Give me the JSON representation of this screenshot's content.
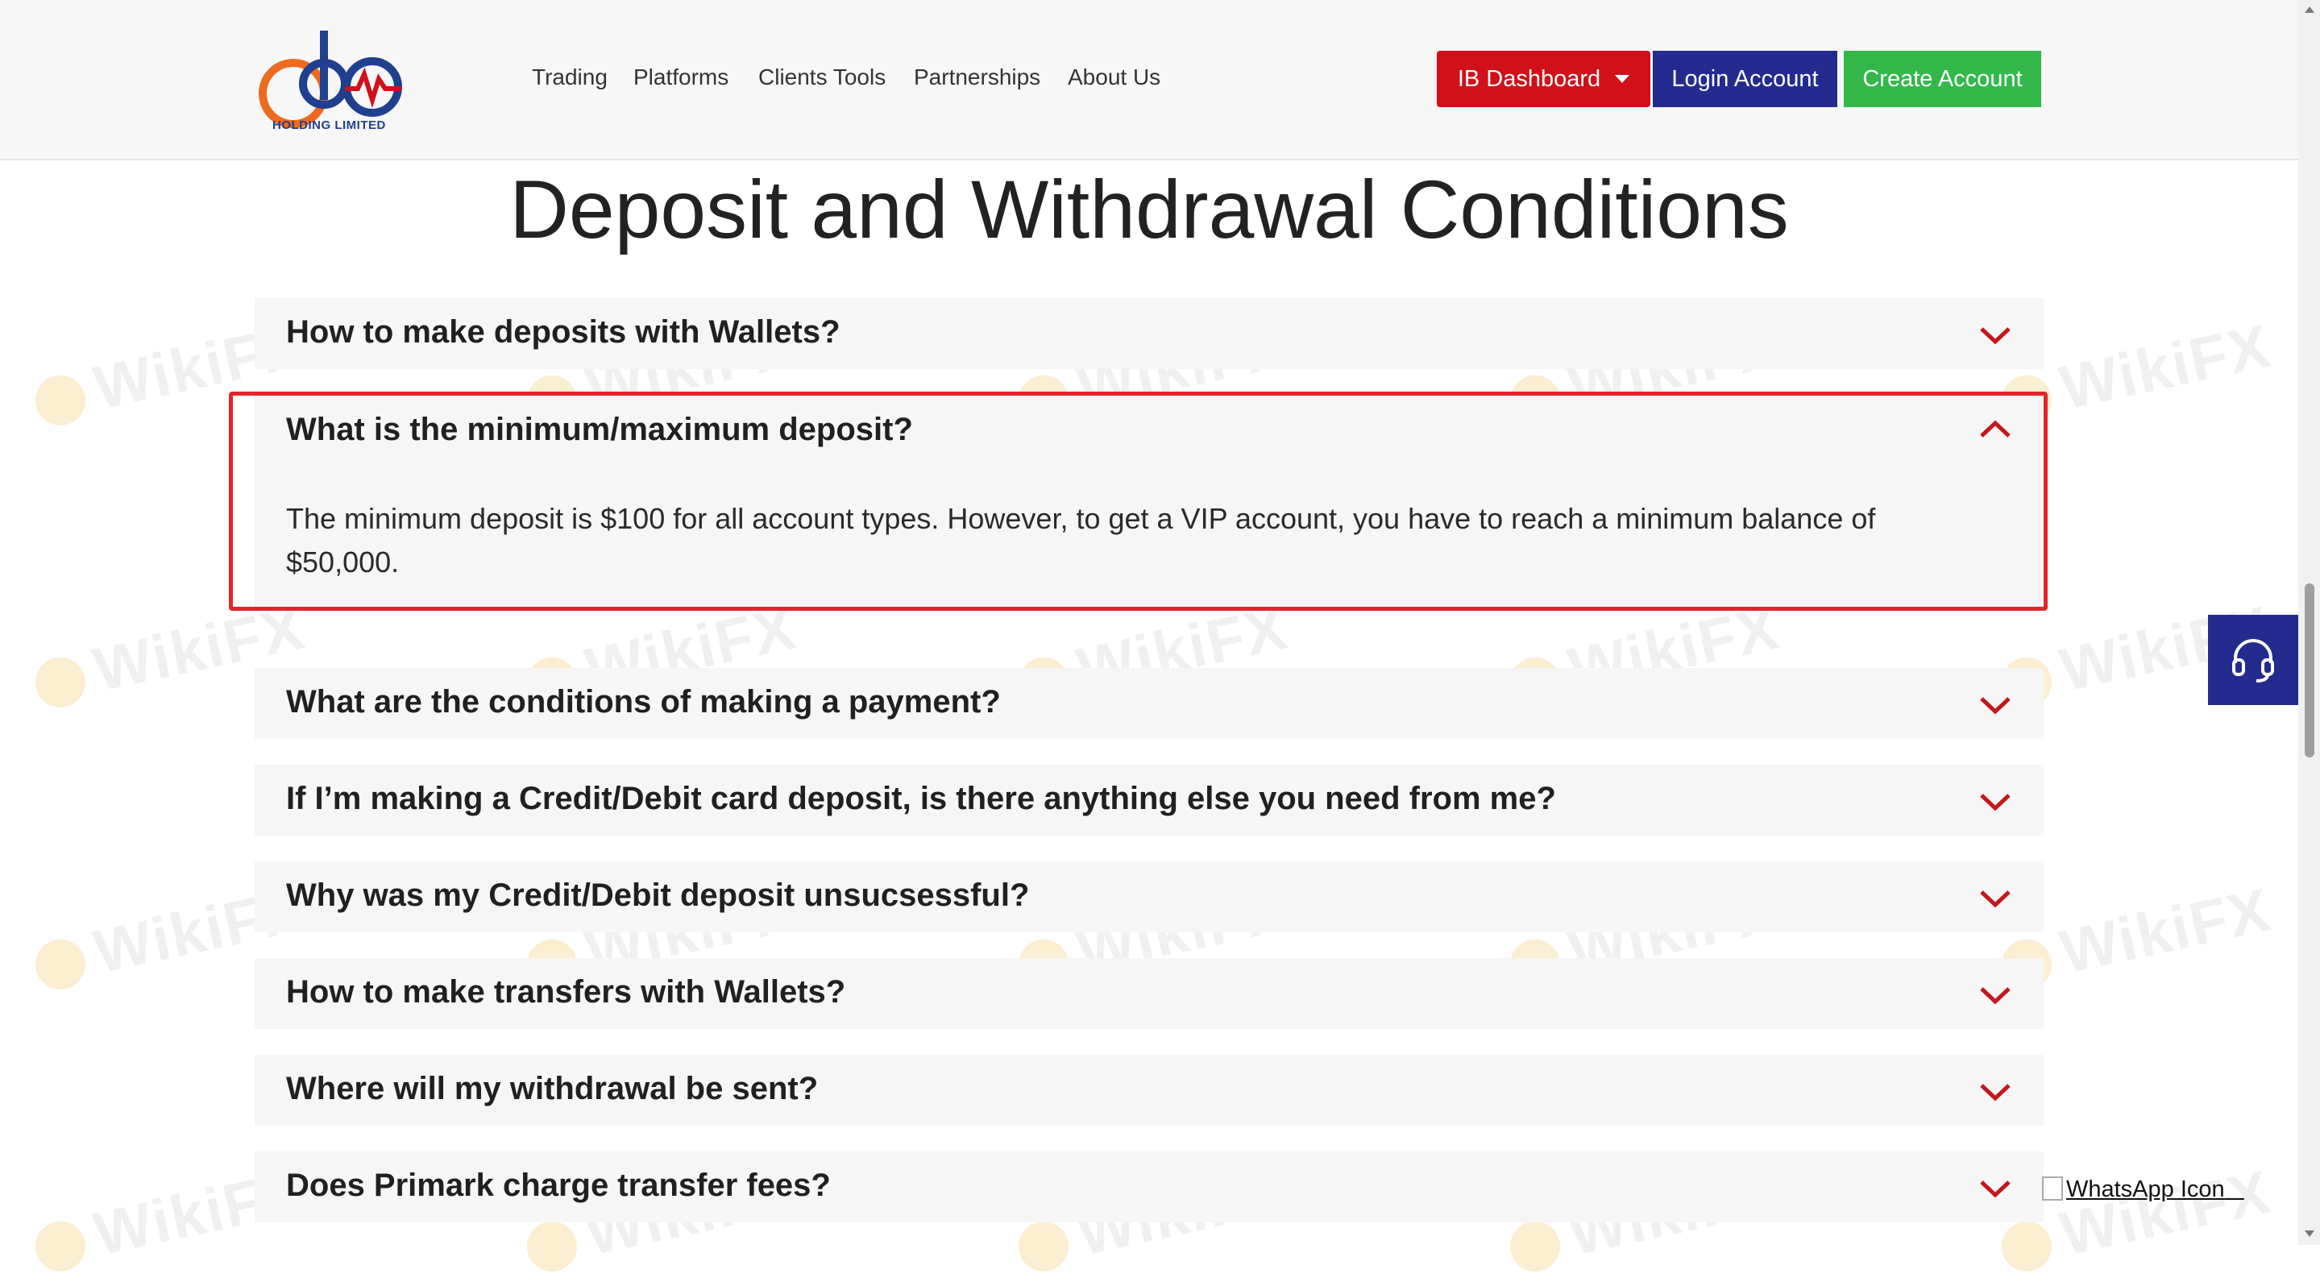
{
  "header": {
    "logo_caption": "HOLDING LIMITED",
    "nav": [
      "Trading",
      "Platforms",
      "Clients Tools",
      "Partnerships",
      "About Us"
    ],
    "buttons": {
      "ib_dashboard": "IB Dashboard",
      "login": "Login Account",
      "create": "Create Account"
    }
  },
  "page": {
    "title": "Deposit and Withdrawal Conditions"
  },
  "faq": [
    {
      "question": "How to make deposits with Wallets?",
      "expanded": false
    },
    {
      "question": "What is the minimum/maximum deposit?",
      "expanded": true,
      "answer": "The minimum deposit is $100 for all account types. However, to get a VIP account, you have to reach a minimum balance of $50,000."
    },
    {
      "question": "What are the conditions of making a payment?",
      "expanded": false
    },
    {
      "question": "If I’m making a Credit/Debit card deposit, is there anything else you need from me?",
      "expanded": false
    },
    {
      "question": "Why was my Credit/Debit deposit unsucsessful?",
      "expanded": false
    },
    {
      "question": "How to make transfers with Wallets?",
      "expanded": false
    },
    {
      "question": "Where will my withdrawal be sent?",
      "expanded": false
    },
    {
      "question": "Does Primark charge transfer fees?",
      "expanded": false
    }
  ],
  "widgets": {
    "whatsapp_alt": "WhatsApp Icon",
    "support_icon": "headset-icon"
  },
  "watermark": "WikiFX",
  "colors": {
    "accent_red": "#d0101a",
    "navy": "#232b8f",
    "green": "#34b84a",
    "highlight": "#e0262b"
  }
}
